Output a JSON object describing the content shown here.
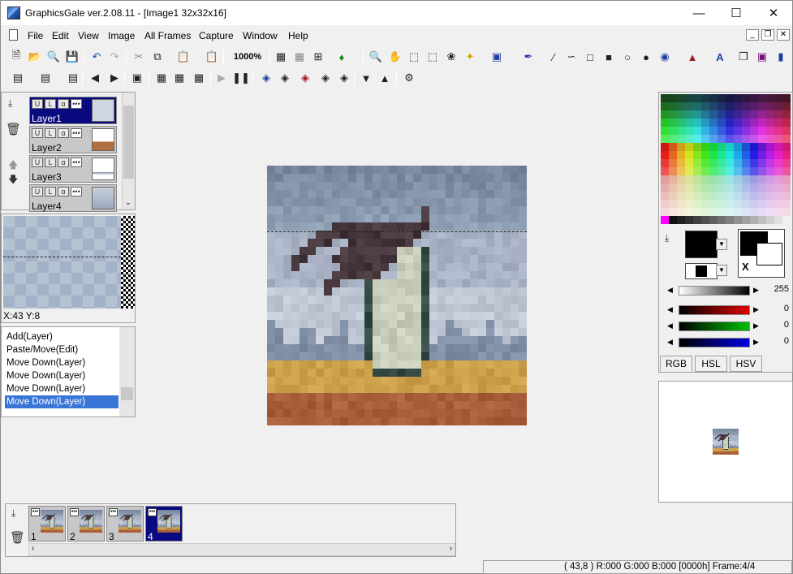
{
  "window": {
    "title": "GraphicsGale ver.2.08.11 - [Image1 32x32x16]"
  },
  "menu": [
    "File",
    "Edit",
    "View",
    "Image",
    "All Frames",
    "Capture",
    "Window",
    "Help"
  ],
  "toolbar": {
    "zoom": "1000%"
  },
  "layers": [
    {
      "name": "Layer1",
      "selected": true
    },
    {
      "name": "Layer2",
      "selected": false
    },
    {
      "name": "Layer3",
      "selected": false
    },
    {
      "name": "Layer4",
      "selected": false
    }
  ],
  "layer_flags": {
    "u": "U",
    "l": "L",
    "alpha": "α",
    "more": "•••"
  },
  "preview": {
    "coords": "X:43 Y:8"
  },
  "history": [
    {
      "label": "Add(Layer)",
      "selected": false
    },
    {
      "label": "Paste/Move(Edit)",
      "selected": false
    },
    {
      "label": "Move Down(Layer)",
      "selected": false
    },
    {
      "label": "Move Down(Layer)",
      "selected": false
    },
    {
      "label": "Move Down(Layer)",
      "selected": false
    },
    {
      "label": "Move Down(Layer)",
      "selected": true
    }
  ],
  "color": {
    "swap_label": "X",
    "tabs": [
      "RGB",
      "HSL",
      "HSV"
    ],
    "active_tab": "RGB",
    "sliders": [
      {
        "name": "gray",
        "value": "255",
        "color": "#000000"
      },
      {
        "name": "red",
        "value": "0",
        "color": "#e00000"
      },
      {
        "name": "green",
        "value": "0",
        "color": "#00c000"
      },
      {
        "name": "blue",
        "value": "0",
        "color": "#0000e0"
      }
    ],
    "foreground": "#000000",
    "background": "#ffffff"
  },
  "frames": [
    {
      "number": "1",
      "selected": false
    },
    {
      "number": "2",
      "selected": false
    },
    {
      "number": "3",
      "selected": false
    },
    {
      "number": "4",
      "selected": true
    }
  ],
  "status": {
    "text": "( 43,8 ) R:000 G:000 B:000  [0000h]  Frame:4/4"
  }
}
